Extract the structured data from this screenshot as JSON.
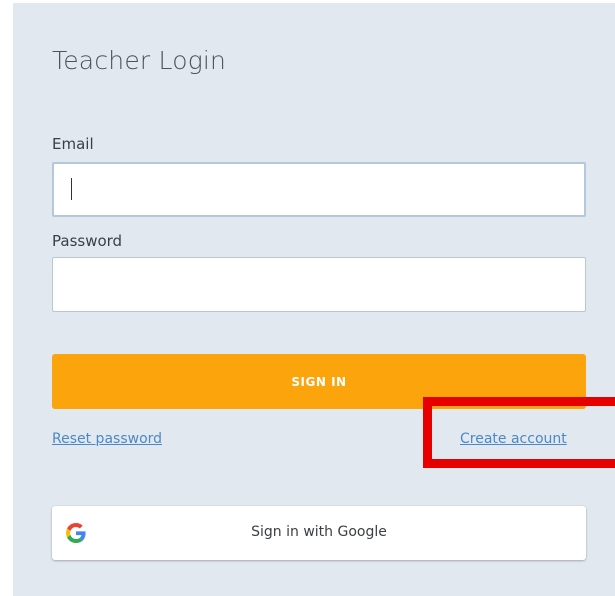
{
  "login": {
    "title": "Teacher Login",
    "email_label": "Email",
    "email_value": "",
    "password_label": "Password",
    "password_value": "",
    "signin_label": "SIGN IN",
    "reset_label": "Reset password",
    "create_label": "Create account",
    "google_label": "Sign in with Google",
    "google_icon": "google-g-icon"
  },
  "colors": {
    "card_background": "#e2e8f0",
    "signin_button": "#fba40c",
    "link": "#4a89c5",
    "highlight": "#e60000"
  }
}
